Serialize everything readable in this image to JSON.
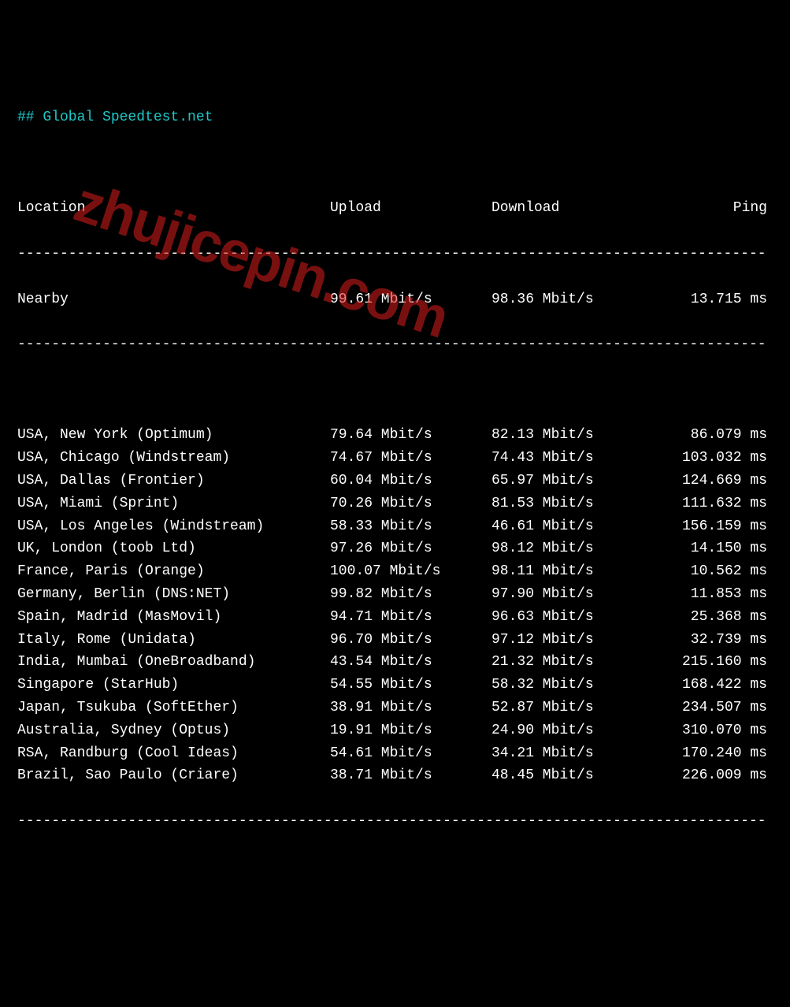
{
  "title": "## Global Speedtest.net",
  "columns": {
    "location": "Location",
    "upload": "Upload",
    "download": "Download",
    "ping": "Ping"
  },
  "divider": "----------------------------------------------------------------------------------------",
  "nearby": {
    "location": "Nearby",
    "upload": "99.61 Mbit/s",
    "download": "98.36 Mbit/s",
    "ping": "13.715 ms"
  },
  "rows": [
    {
      "location": "USA, New York (Optimum)",
      "upload": "79.64 Mbit/s",
      "download": "82.13 Mbit/s",
      "ping": "86.079 ms"
    },
    {
      "location": "USA, Chicago (Windstream)",
      "upload": "74.67 Mbit/s",
      "download": "74.43 Mbit/s",
      "ping": "103.032 ms"
    },
    {
      "location": "USA, Dallas (Frontier)",
      "upload": "60.04 Mbit/s",
      "download": "65.97 Mbit/s",
      "ping": "124.669 ms"
    },
    {
      "location": "USA, Miami (Sprint)",
      "upload": "70.26 Mbit/s",
      "download": "81.53 Mbit/s",
      "ping": "111.632 ms"
    },
    {
      "location": "USA, Los Angeles (Windstream)",
      "upload": "58.33 Mbit/s",
      "download": "46.61 Mbit/s",
      "ping": "156.159 ms"
    },
    {
      "location": "UK, London (toob Ltd)",
      "upload": "97.26 Mbit/s",
      "download": "98.12 Mbit/s",
      "ping": "14.150 ms"
    },
    {
      "location": "France, Paris (Orange)",
      "upload": "100.07 Mbit/s",
      "download": "98.11 Mbit/s",
      "ping": "10.562 ms"
    },
    {
      "location": "Germany, Berlin (DNS:NET)",
      "upload": "99.82 Mbit/s",
      "download": "97.90 Mbit/s",
      "ping": "11.853 ms"
    },
    {
      "location": "Spain, Madrid (MasMovil)",
      "upload": "94.71 Mbit/s",
      "download": "96.63 Mbit/s",
      "ping": "25.368 ms"
    },
    {
      "location": "Italy, Rome (Unidata)",
      "upload": "96.70 Mbit/s",
      "download": "97.12 Mbit/s",
      "ping": "32.739 ms"
    },
    {
      "location": "India, Mumbai (OneBroadband)",
      "upload": "43.54 Mbit/s",
      "download": "21.32 Mbit/s",
      "ping": "215.160 ms"
    },
    {
      "location": "Singapore (StarHub)",
      "upload": "54.55 Mbit/s",
      "download": "58.32 Mbit/s",
      "ping": "168.422 ms"
    },
    {
      "location": "Japan, Tsukuba (SoftEther)",
      "upload": "38.91 Mbit/s",
      "download": "52.87 Mbit/s",
      "ping": "234.507 ms"
    },
    {
      "location": "Australia, Sydney (Optus)",
      "upload": "19.91 Mbit/s",
      "download": "24.90 Mbit/s",
      "ping": "310.070 ms"
    },
    {
      "location": "RSA, Randburg (Cool Ideas)",
      "upload": "54.61 Mbit/s",
      "download": "34.21 Mbit/s",
      "ping": "170.240 ms"
    },
    {
      "location": "Brazil, Sao Paulo (Criare)",
      "upload": "38.71 Mbit/s",
      "download": "48.45 Mbit/s",
      "ping": "226.009 ms"
    }
  ],
  "watermark": "zhujicepin.com"
}
